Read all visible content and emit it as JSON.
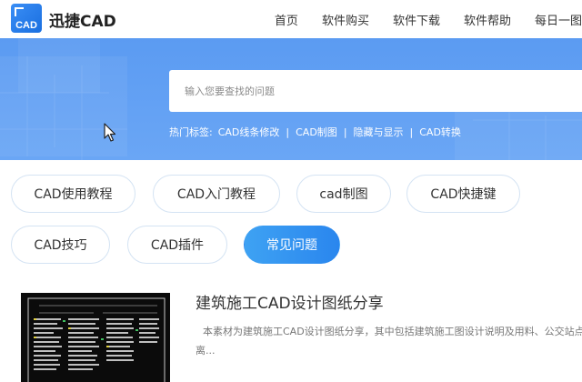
{
  "header": {
    "logo_text": "CAD",
    "brand": "迅捷CAD",
    "nav": [
      "首页",
      "软件购买",
      "软件下载",
      "软件帮助",
      "每日一图"
    ]
  },
  "search": {
    "placeholder": "输入您要查找的问题"
  },
  "hot_tags": {
    "label": "热门标签:",
    "tags": [
      "CAD线条修改",
      "CAD制图",
      "隐藏与显示",
      "CAD转换"
    ],
    "separator": "|"
  },
  "categories": [
    {
      "label": "CAD使用教程",
      "active": false
    },
    {
      "label": "CAD入门教程",
      "active": false
    },
    {
      "label": "cad制图",
      "active": false
    },
    {
      "label": "CAD快捷键",
      "active": false
    },
    {
      "label": "CAD技巧",
      "active": false
    },
    {
      "label": "CAD插件",
      "active": false
    },
    {
      "label": "常见问题",
      "active": true
    }
  ],
  "article": {
    "title": "建筑施工CAD设计图纸分享",
    "desc": "本素材为建筑施工CAD设计图纸分享，其中包括建筑施工图设计说明及用料、公交站点距离..."
  },
  "colors": {
    "banner": "#5b9bf2",
    "accent": "#2a86ee",
    "cat_border": "#d4e3f3"
  },
  "icons": {
    "logo": "cad-logo-icon",
    "cursor": "mouse-pointer-icon"
  }
}
